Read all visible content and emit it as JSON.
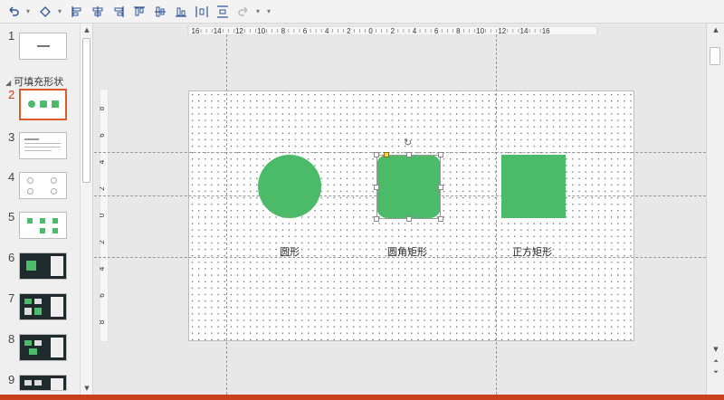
{
  "toolbar": {
    "icons": [
      "undo-icon",
      "shape-icon",
      "align-left-icon",
      "align-center-icon",
      "align-right-icon",
      "align-top-icon",
      "align-middle-icon",
      "align-bottom-icon",
      "distribute-h-icon",
      "distribute-v-icon",
      "redo-icon"
    ]
  },
  "slides_panel": {
    "section_title": "可填充形状",
    "slides": [
      {
        "num": "1",
        "active": false,
        "dark": false
      },
      {
        "num": "2",
        "active": true,
        "dark": false
      },
      {
        "num": "3",
        "active": false,
        "dark": false
      },
      {
        "num": "4",
        "active": false,
        "dark": false
      },
      {
        "num": "5",
        "active": false,
        "dark": false
      },
      {
        "num": "6",
        "active": false,
        "dark": true
      },
      {
        "num": "7",
        "active": false,
        "dark": true
      },
      {
        "num": "8",
        "active": false,
        "dark": true
      },
      {
        "num": "9",
        "active": false,
        "dark": true
      }
    ]
  },
  "ruler": {
    "horizontal": [
      "16",
      "14",
      "12",
      "10",
      "8",
      "6",
      "4",
      "2",
      "0",
      "2",
      "4",
      "6",
      "8",
      "10",
      "12",
      "14",
      "16"
    ],
    "vertical": [
      "8",
      "6",
      "4",
      "2",
      "0",
      "2",
      "4",
      "6",
      "8"
    ]
  },
  "slide": {
    "labels": {
      "circle": "圆形",
      "rounded_rect": "圆角矩形",
      "square": "正方矩形"
    },
    "accent_color": "#4bbb6a"
  }
}
